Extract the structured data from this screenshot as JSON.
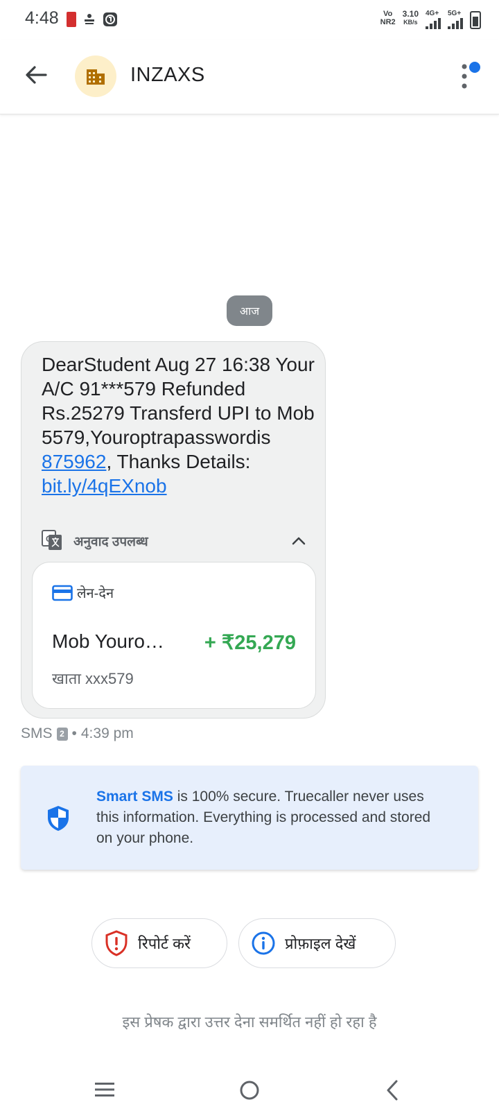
{
  "status_bar": {
    "time": "4:48",
    "volte": "Vo",
    "volte_sub": "NR2",
    "speed": "3.10",
    "speed_unit": "KB/s",
    "net1": "4G+",
    "net2": "5G+"
  },
  "header": {
    "sender_name": "INZAXS"
  },
  "conversation": {
    "date_chip": "आज",
    "message": {
      "line1": "DearStudent Aug 27 16:38 Your A/C 91***579 Refunded Rs.25279 Transferd UPI to Mob 5579,Youroptrapasswordis ",
      "otp_link": "875962",
      "line2": ", Thanks Details: ",
      "url": "bit.ly/4qEXnob"
    },
    "translate_label": "अनुवाद उपलब्ध",
    "transaction": {
      "type_label": "लेन-देन",
      "merchant": "Mob Youro…",
      "amount": "+ ₹25,279",
      "account": "खाता xxx579"
    },
    "meta": {
      "channel": "SMS",
      "sim": "2",
      "separator": "•",
      "time": "4:39 pm"
    }
  },
  "smart_sms_banner": {
    "brand": "Smart SMS",
    "text": " is 100% secure. Truecaller never uses this information. Everything is processed and stored on your phone."
  },
  "actions": {
    "report_label": "रिपोर्ट करें",
    "profile_label": "प्रोफ़ाइल देखें"
  },
  "footer_note": "इस प्रेषक द्वारा उत्तर देना समर्थित नहीं हो रहा है",
  "colors": {
    "accent_blue": "#1a73e8",
    "amount_green": "#34a853",
    "report_red": "#d93025",
    "banner_bg": "#e7effc"
  }
}
